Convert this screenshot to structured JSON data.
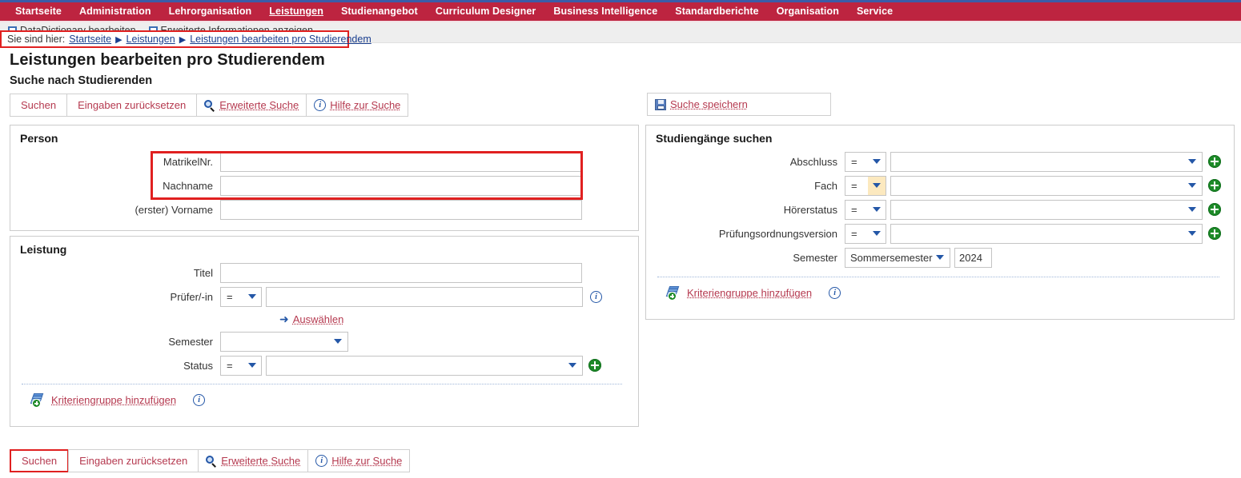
{
  "topnav": {
    "items": [
      {
        "label": "Startseite",
        "active": false
      },
      {
        "label": "Administration",
        "active": false
      },
      {
        "label": "Lehrorganisation",
        "active": false
      },
      {
        "label": "Leistungen",
        "active": true
      },
      {
        "label": "Studienangebot",
        "active": false
      },
      {
        "label": "Curriculum Designer",
        "active": false
      },
      {
        "label": "Business Intelligence",
        "active": false
      },
      {
        "label": "Standardberichte",
        "active": false
      },
      {
        "label": "Organisation",
        "active": false
      },
      {
        "label": "Service",
        "active": false
      }
    ]
  },
  "subbar": {
    "checkboxes": [
      {
        "label": "DataDictionary bearbeiten",
        "checked": false
      },
      {
        "label": "Erweiterte Informationen anzeigen",
        "checked": false
      }
    ]
  },
  "breadcrumb": {
    "lead": "Sie sind hier:",
    "items": [
      "Startseite",
      "Leistungen",
      "Leistungen bearbeiten pro Studierendem"
    ],
    "separator": "▶"
  },
  "page": {
    "title": "Leistungen bearbeiten pro Studierendem",
    "section_title": "Suche nach Studierenden"
  },
  "toolbar_top": {
    "search_label": "Suchen",
    "reset_label": "Eingaben zurücksetzen",
    "advanced_label": "Erweiterte Suche",
    "help_label": "Hilfe zur Suche",
    "search_icon": "magnifier-icon",
    "info_icon": "info-icon"
  },
  "toolbar_right": {
    "save_label": "Suche speichern",
    "save_icon": "floppy-save-icon"
  },
  "toolbar_bottom": {
    "search_label": "Suchen",
    "reset_label": "Eingaben zurücksetzen",
    "advanced_label": "Erweiterte Suche",
    "help_label": "Hilfe zur Suche"
  },
  "person_panel": {
    "legend": "Person",
    "fields": [
      {
        "label": "MatrikelNr.",
        "value": "",
        "type": "text"
      },
      {
        "label": "Nachname",
        "value": "",
        "type": "text"
      },
      {
        "label": "(erster) Vorname",
        "value": "",
        "type": "text"
      }
    ]
  },
  "leistung_panel": {
    "legend": "Leistung",
    "titel": {
      "label": "Titel",
      "value": ""
    },
    "pruefer": {
      "label": "Prüfer/-in",
      "operator": "=",
      "value": "",
      "info_icon": "info-icon"
    },
    "auswaehlen": {
      "label": "Auswählen",
      "icon": "arrow-right-icon"
    },
    "semester": {
      "label": "Semester",
      "value": ""
    },
    "status": {
      "label": "Status",
      "operator": "=",
      "value": "",
      "add_icon": "plus-circle-icon"
    },
    "add_group": {
      "label": "Kriteriengruppe hinzufügen",
      "icon": "add-layers-icon",
      "info_icon": "info-icon"
    }
  },
  "studiengaenge_panel": {
    "legend": "Studiengänge suchen",
    "rows": [
      {
        "label": "Abschluss",
        "operator": "=",
        "value": "",
        "focused": false
      },
      {
        "label": "Fach",
        "operator": "=",
        "value": "",
        "focused": true
      },
      {
        "label": "Hörerstatus",
        "operator": "=",
        "value": "",
        "focused": false
      },
      {
        "label": "Prüfungsordnungsversion",
        "operator": "=",
        "value": "",
        "focused": false
      }
    ],
    "semester": {
      "label": "Semester",
      "term": "Sommersemester",
      "year": "2024"
    },
    "add_group": {
      "label": "Kriteriengruppe hinzufügen",
      "icon": "add-layers-icon",
      "info_icon": "info-icon"
    }
  },
  "colors": {
    "brand_red": "#bd2440",
    "link_red": "#b5394f",
    "link_blue": "#1a3f8f",
    "highlight_red": "#e02020",
    "accent_green": "#1d8a28",
    "focus_yellow": "#fce9bf"
  }
}
